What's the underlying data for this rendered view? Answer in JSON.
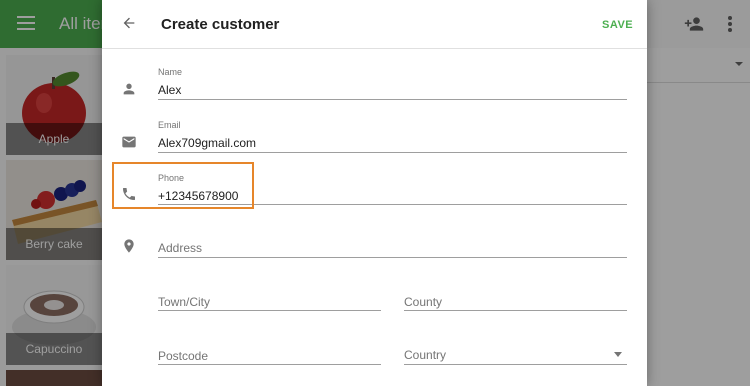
{
  "background": {
    "title": "All item",
    "tiles": [
      {
        "label": "Apple"
      },
      {
        "label": "Berry cake"
      },
      {
        "label": "Capuccino"
      }
    ]
  },
  "dialog": {
    "title": "Create customer",
    "save_label": "SAVE",
    "fields": {
      "name": {
        "label": "Name",
        "value": "Alex"
      },
      "email": {
        "label": "Email",
        "value": "Alex709gmail.com"
      },
      "phone": {
        "label": "Phone",
        "value": "+12345678900"
      },
      "address": {
        "placeholder": "Address"
      },
      "town": {
        "placeholder": "Town/City"
      },
      "county": {
        "placeholder": "County"
      },
      "postcode": {
        "placeholder": "Postcode"
      },
      "country": {
        "placeholder": "Country"
      }
    }
  },
  "colors": {
    "accent": "#4caf50",
    "highlight": "#e6862a"
  },
  "icons": [
    "menu-icon",
    "add-person-icon",
    "more-vert-icon",
    "back-arrow-icon",
    "person-icon",
    "email-icon",
    "phone-icon",
    "location-icon",
    "dropdown-caret-icon"
  ]
}
